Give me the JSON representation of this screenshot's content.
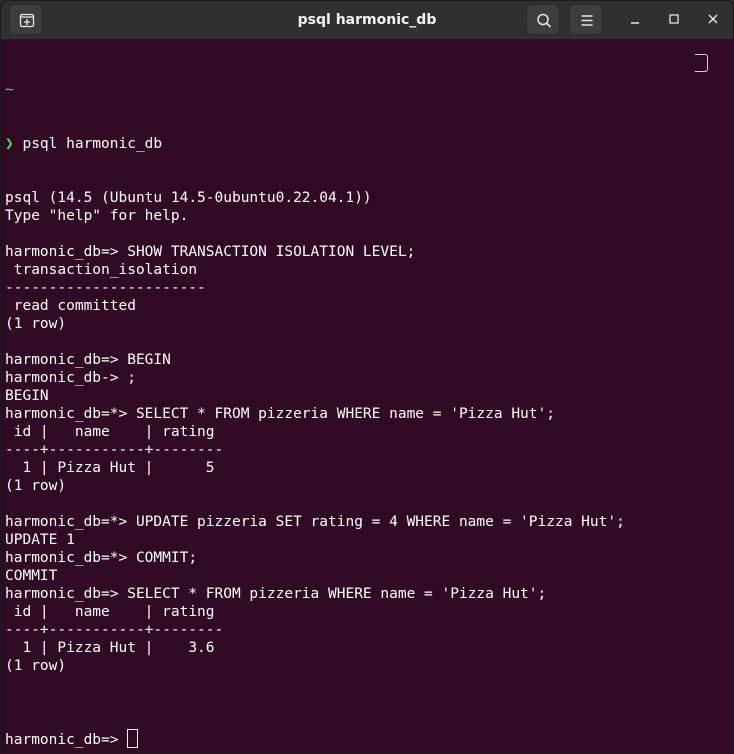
{
  "window": {
    "title": "psql harmonic_db"
  },
  "icons": {
    "new_tab": "new-tab-icon",
    "search": "search-icon",
    "menu": "hamburger-menu-icon",
    "minimize": "minimize-icon",
    "maximize": "maximize-icon",
    "close": "close-icon"
  },
  "colors": {
    "background": "#300a24",
    "titlebar": "#303030",
    "text": "#ffffff",
    "prompt_chevron": "#4ee44e",
    "tilde": "#34e2e2"
  },
  "terminal": {
    "cwd": "~",
    "chevron": "❯",
    "command": "psql harmonic_db",
    "lines": [
      "psql (14.5 (Ubuntu 14.5-0ubuntu0.22.04.1))",
      "Type \"help\" for help.",
      "",
      "harmonic_db=> SHOW TRANSACTION ISOLATION LEVEL;",
      " transaction_isolation",
      "-----------------------",
      " read committed",
      "(1 row)",
      "",
      "harmonic_db=> BEGIN",
      "harmonic_db-> ;",
      "BEGIN",
      "harmonic_db=*> SELECT * FROM pizzeria WHERE name = 'Pizza Hut';",
      " id |   name    | rating",
      "----+-----------+--------",
      "  1 | Pizza Hut |      5",
      "(1 row)",
      "",
      "harmonic_db=*> UPDATE pizzeria SET rating = 4 WHERE name = 'Pizza Hut';",
      "UPDATE 1",
      "harmonic_db=*> COMMIT;",
      "COMMIT",
      "harmonic_db=> SELECT * FROM pizzeria WHERE name = 'Pizza Hut';",
      " id |   name    | rating",
      "----+-----------+--------",
      "  1 | Pizza Hut |    3.6",
      "(1 row)",
      ""
    ],
    "final_prompt": "harmonic_db=> "
  }
}
